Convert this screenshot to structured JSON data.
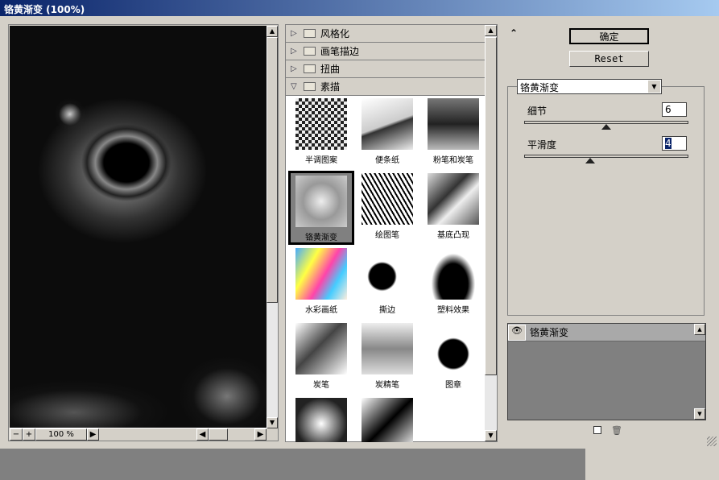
{
  "window": {
    "title": "铬黄渐变 (100%)"
  },
  "preview": {
    "zoom_out": "−",
    "zoom_in": "+",
    "zoom_level": "100 %"
  },
  "categories": [
    {
      "label": "风格化",
      "expanded": false
    },
    {
      "label": "画笔描边",
      "expanded": false
    },
    {
      "label": "扭曲",
      "expanded": false
    },
    {
      "label": "素描",
      "expanded": true
    }
  ],
  "filters": [
    "半调图案",
    "便条纸",
    "粉笔和炭笔",
    "铬黄渐变",
    "绘图笔",
    "基底凸现",
    "水彩画纸",
    "撕边",
    "塑料效果",
    "炭笔",
    "炭精笔",
    "图章",
    "",
    ""
  ],
  "selected_filter": "铬黄渐变",
  "buttons": {
    "ok": "确定",
    "reset": "Reset",
    "collapse": "⌃"
  },
  "settings": {
    "filter_select": "铬黄渐变",
    "detail": {
      "label": "细节",
      "value": "6",
      "fraction": 0.5
    },
    "smoothness": {
      "label": "平滑度",
      "value": "4",
      "fraction": 0.4
    }
  },
  "layers": [
    {
      "name": "铬黄渐变",
      "visible": true
    }
  ]
}
